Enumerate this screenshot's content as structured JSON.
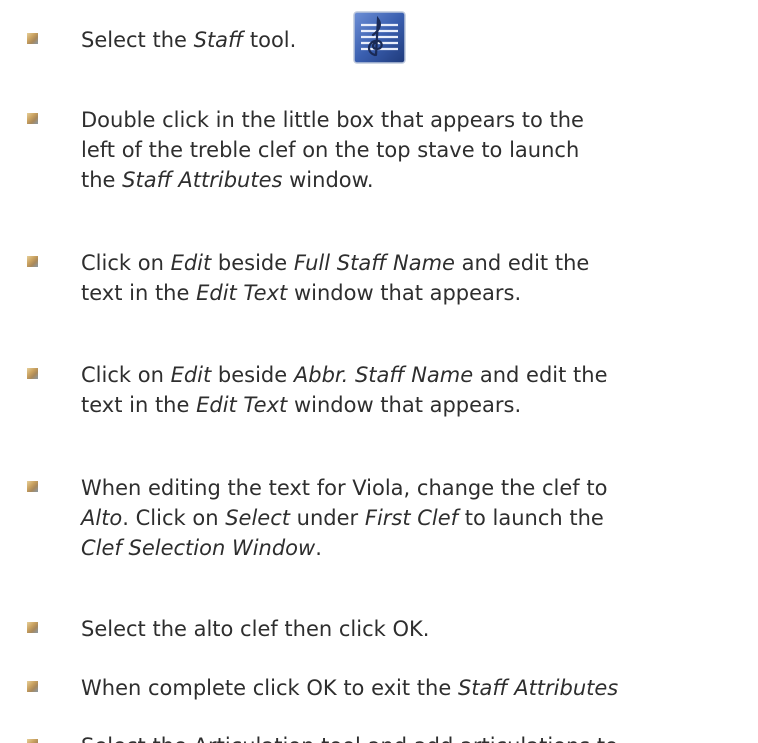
{
  "items": [
    {
      "parts": [
        [
          "Select the ",
          ""
        ],
        [
          "Staff",
          "em"
        ],
        [
          " tool.",
          ""
        ]
      ]
    },
    {
      "lines": [
        [
          [
            "Double click in the little box that appears to the",
            ""
          ]
        ],
        [
          [
            "left of the treble clef on the top stave to launch",
            ""
          ]
        ],
        [
          [
            "the ",
            ""
          ],
          [
            "Staff Attributes",
            "em"
          ],
          [
            " window.",
            ""
          ]
        ]
      ]
    },
    {
      "lines": [
        [
          [
            "Click on ",
            ""
          ],
          [
            "Edit",
            "em"
          ],
          [
            " beside ",
            ""
          ],
          [
            "Full Staff Name",
            "em"
          ],
          [
            " and edit the",
            ""
          ]
        ],
        [
          [
            "text in the ",
            ""
          ],
          [
            "Edit Text",
            "em"
          ],
          [
            " window that appears.",
            ""
          ]
        ]
      ]
    },
    {
      "lines": [
        [
          [
            "Click on ",
            ""
          ],
          [
            "Edit",
            "em"
          ],
          [
            " beside ",
            ""
          ],
          [
            "Abbr. Staff Name",
            "em"
          ],
          [
            " and edit the",
            ""
          ]
        ],
        [
          [
            "text in the ",
            ""
          ],
          [
            "Edit Text",
            "em"
          ],
          [
            " window that appears.",
            ""
          ]
        ]
      ]
    },
    {
      "lines": [
        [
          [
            "When editing the text for Viola, change the clef to",
            ""
          ]
        ],
        [
          [
            "Alto",
            "em"
          ],
          [
            ". Click on ",
            ""
          ],
          [
            "Select",
            "em"
          ],
          [
            " under ",
            ""
          ],
          [
            "First Clef",
            "em"
          ],
          [
            " to launch the",
            ""
          ]
        ],
        [
          [
            "Clef Selection Window",
            "em"
          ],
          [
            ".",
            ""
          ]
        ]
      ]
    },
    {
      "lines": [
        [
          [
            "Select the alto clef then click OK.",
            ""
          ]
        ]
      ]
    },
    {
      "lines": [
        [
          [
            "When complete click OK to exit the ",
            ""
          ],
          [
            "Staff Attributes",
            "em"
          ]
        ]
      ]
    },
    {
      "lines": [
        [
          [
            "Select the Articulation tool and add articulations to",
            ""
          ]
        ]
      ]
    }
  ],
  "icon": {
    "name": "staff-tool-icon",
    "bg": "#3a5fb0"
  },
  "bullet_color": "#c9a15f",
  "text_color": "#2e2e2e"
}
